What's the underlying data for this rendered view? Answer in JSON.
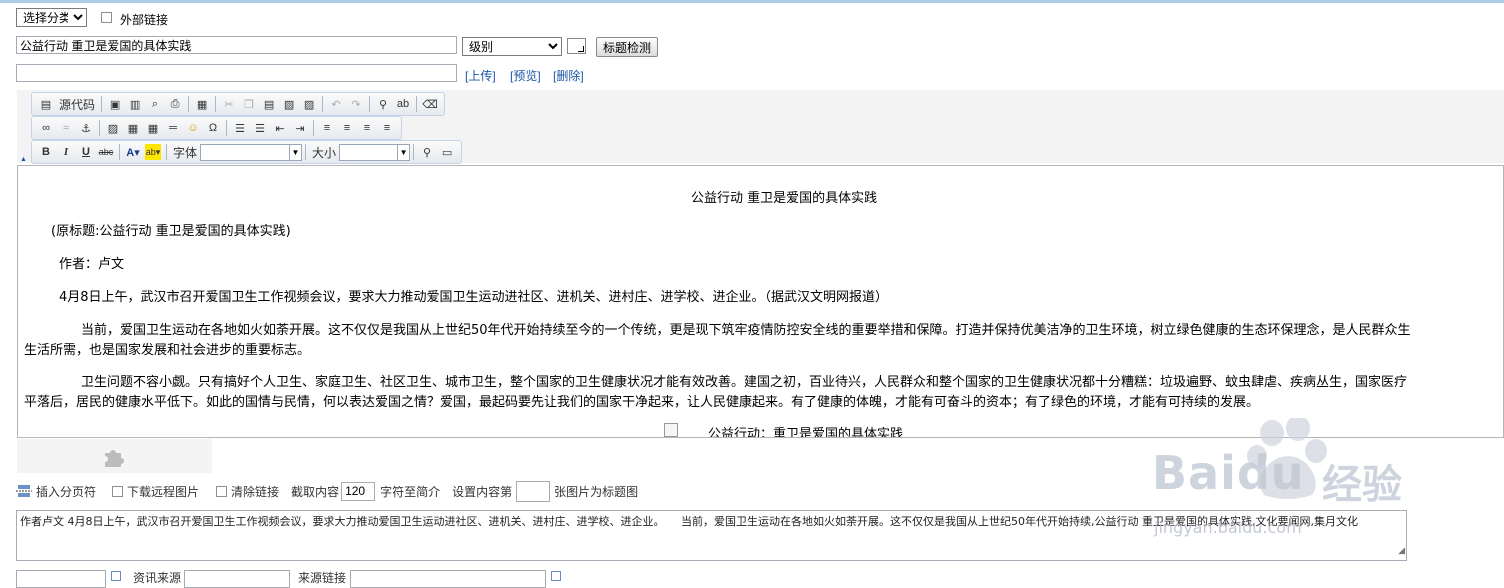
{
  "row1": {
    "category_select": "选择分类",
    "external_link_label": "外部链接"
  },
  "row2": {
    "title_value": "公益行动 重卫是爱国的具体实践",
    "level_select": "级别",
    "check_title_button": "标题检测"
  },
  "row3": {
    "upload_link": "[上传]",
    "preview_link": "[预览]",
    "delete_link": "[删除]"
  },
  "toolbar": {
    "source_label": "源代码",
    "font_label": "字体",
    "size_label": "大小"
  },
  "editor": {
    "heading": "公益行动 重卫是爱国的具体实践",
    "orig_title": "(原标题:公益行动 重卫是爱国的具体实践)",
    "author": "作者：卢文",
    "p1": "4月8日上午，武汉市召开爱国卫生工作视频会议，要求大力推动爱国卫生运动进社区、进机关、进村庄、进学校、进企业。（据武汉文明网报道）",
    "p2a": "当前，爱国卫生运动在各地如火如荼开展。这不仅仅是我国从上世纪50年代开始持续至今的一个传统，更是现下筑牢疫情防控安全线的重要举措和保障。打造并保持优美洁净的卫生环境，树立绿色健康的生态环保理念，是人民群众生",
    "p2b": "生活所需，也是国家发展和社会进步的重要标志。",
    "p3a": "卫生问题不容小觑。只有搞好个人卫生、家庭卫生、社区卫生、城市卫生，整个国家的卫生健康状况才能有效改善。建国之初，百业待兴，人民群众和整个国家的卫生健康状况都十分糟糕：垃圾遍野、蚊虫肆虐、疾病丛生，国家医疗",
    "p3b": "平落后，居民的健康水平低下。如此的国情与民情，何以表达爱国之情？爱国，最起码要先让我们的国家干净起来，让人民健康起来。有了健康的体魄，才能有可奋斗的资本；有了绿色的环境，才能有可持续的发展。",
    "image_caption": "公益行动：重卫是爱国的具体实践"
  },
  "bottom": {
    "insert_page": "插入分页符",
    "download_remote": "下载远程图片",
    "clear_links": "清除链接",
    "truncate_label": "截取内容",
    "truncate_value": "120",
    "chars_label": "字符至简介",
    "set_content_label": "设置内容第",
    "image_num_value": "",
    "image_as_title": "张图片为标题图"
  },
  "summary": "作者卢文 4月8日上午，武汉市召开爱国卫生工作视频会议，要求大力推动爱国卫生运动进社区、进机关、进村庄、进学校、进企业。　　当前，爱国卫生运动在各地如火如荼开展。这不仅仅是我国从上世纪50年代开始持续,公益行动 重卫是爱国的具体实践,文化要闻网,集月文化",
  "bottom_row2": {
    "source_label": "资讯来源",
    "source_link_label": "来源链接"
  },
  "watermark": {
    "brand": "Baidu",
    "cn": "经验",
    "url": "jingyan.baidu.com"
  }
}
